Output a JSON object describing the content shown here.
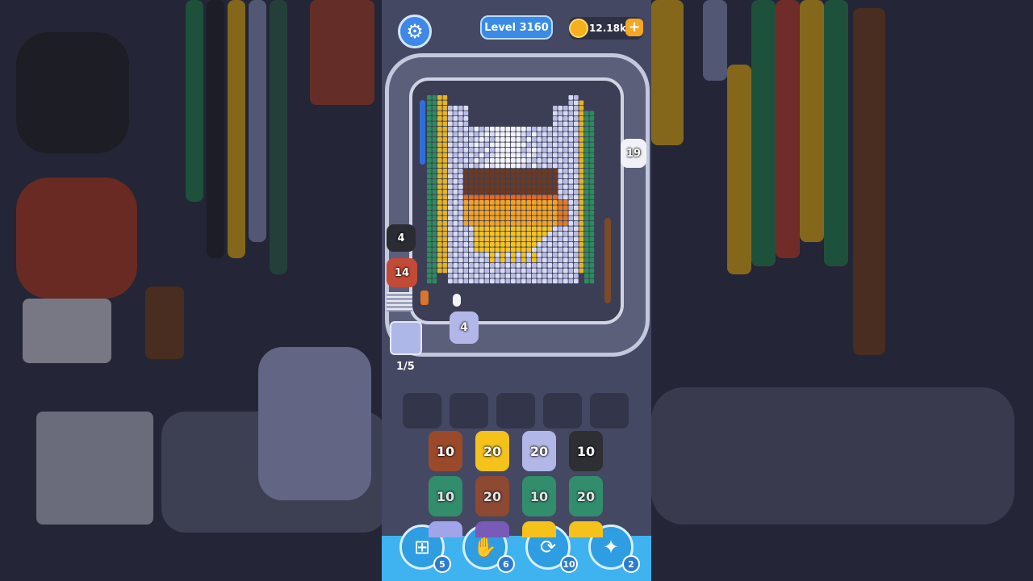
{
  "header": {
    "level_label": "Level 3160",
    "coins": "12.18k",
    "settings_icon": "gear-icon",
    "add_coins_icon": "plus-icon"
  },
  "track": {
    "queue_progress": "1/5",
    "right_pig_count": "19",
    "left_pig_top_count": "4",
    "left_pig_bottom_count": "14",
    "launcher_pig_count": "4"
  },
  "grid": {
    "rows": [
      {
        "pigs": [
          {
            "count": "10",
            "color": "#9a4a2a"
          },
          {
            "count": "20",
            "color": "#f4c21a"
          },
          {
            "count": "20",
            "color": "#b3b7e8"
          },
          {
            "count": "10",
            "color": "#2e2f33"
          }
        ]
      },
      {
        "pigs": [
          {
            "count": "10",
            "color": "#2f9a6e"
          },
          {
            "count": "20",
            "color": "#9a4a2a"
          },
          {
            "count": "10",
            "color": "#2f9a6e"
          },
          {
            "count": "20",
            "color": "#2f9a6e"
          }
        ]
      }
    ]
  },
  "powerups": [
    {
      "icon": "add-slot-icon",
      "count": "5"
    },
    {
      "icon": "hand-icon",
      "count": "6"
    },
    {
      "icon": "shuffle-icon",
      "count": "10"
    },
    {
      "icon": "magnet-pig-icon",
      "count": "2"
    }
  ],
  "colors": {
    "accent": "#3a8ae6",
    "bottom_bar": "#3fb3f0",
    "gold": "#f5b01d"
  }
}
